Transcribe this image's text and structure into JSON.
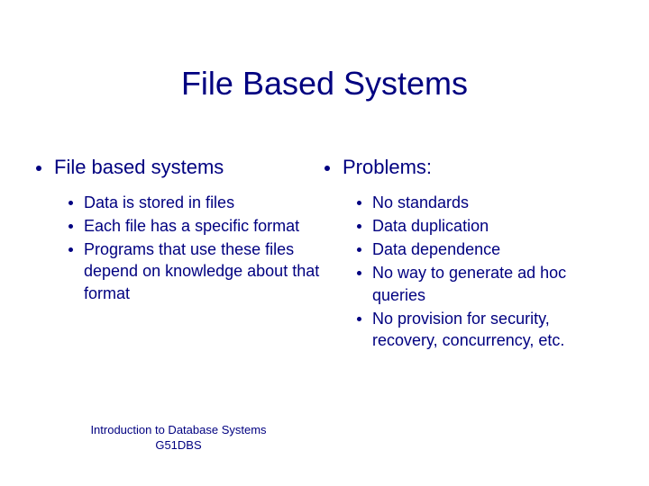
{
  "title": "File Based Systems",
  "left": {
    "heading": "File based systems",
    "items": [
      "Data is stored in files",
      "Each file has a specific format",
      "Programs that use these files depend on knowledge about that format"
    ]
  },
  "right": {
    "heading": "Problems:",
    "items": [
      "No standards",
      "Data duplication",
      "Data dependence",
      "No way to generate ad hoc queries",
      "No provision for security, recovery, concurrency, etc."
    ]
  },
  "footer": {
    "line1": "Introduction to Database Systems",
    "line2": "G51DBS"
  }
}
